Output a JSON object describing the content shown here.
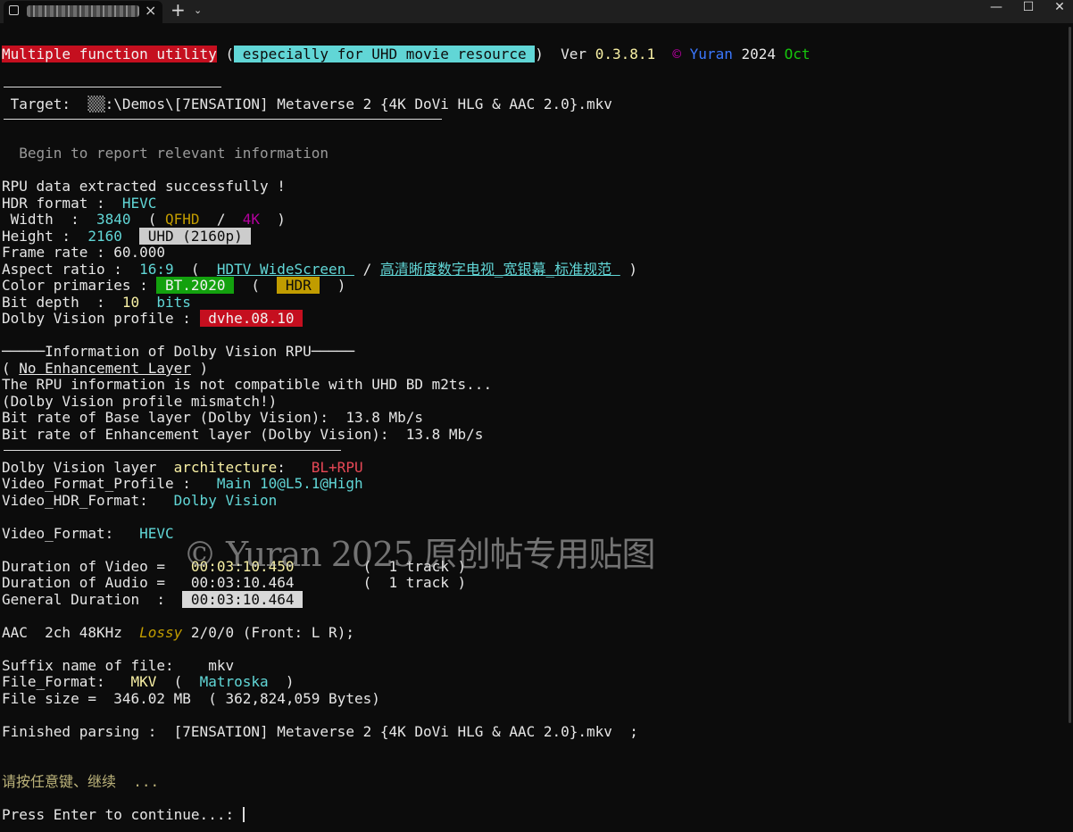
{
  "window": {
    "tab_close": "×",
    "new_tab": "+",
    "dropdown": "⌄",
    "minimize": "—",
    "maximize": "☐",
    "close": "✕"
  },
  "header": {
    "app_badge": "Multiple function utility",
    "paren_open": " (",
    "sub_badge": " especially for UHD movie resource ",
    "paren_close": ")",
    "ver_label": "  Ver ",
    "ver": "0.3.8.1",
    "copyright": "  ©",
    "author": " Yuran",
    "year": " 2024",
    "month": " Oct"
  },
  "target": {
    "label": " Target:  ",
    "drive": "▒▒",
    "path": ":\\Demos\\[7ENSATION] Metaverse 2 {4K DoVi HLG & AAC 2.0}.mkv"
  },
  "begin_msg": "  Begin to report relevant information",
  "info": {
    "rpu_ok": "RPU data extracted successfully !",
    "hdr_label": "HDR format :  ",
    "hdr_value": "HEVC",
    "width_label": " Width  :  ",
    "width_value": "3840",
    "width_paren_open": "  ( ",
    "width_qfhd": "QFHD",
    "width_slash": "  /  ",
    "width_4k": "4K",
    "width_paren_close": "  )",
    "height_label": "Height :  ",
    "height_value": "2160",
    "height_badge": " UHD (2160p) ",
    "fps_label": "Frame rate : ",
    "fps_value": "60.000",
    "aspect_label": "Aspect ratio :  ",
    "aspect_value": "16:9",
    "aspect_paren_open": "  (  ",
    "aspect_en": "HDTV WideScreen ",
    "aspect_slash": " / ",
    "aspect_cn": "高清晰度数字电视_宽银幕_标准规范 ",
    "aspect_paren_close": " )",
    "primaries_label": "Color primaries : ",
    "primaries_value": " BT.2020 ",
    "primaries_paren_open": "  (  ",
    "primaries_hdr": " HDR ",
    "primaries_paren_close": "  )",
    "depth_label": "Bit depth  :  ",
    "depth_value": "10",
    "depth_unit": "  bits",
    "profile_label": "Dolby Vision profile : ",
    "profile_value": " dvhe.08.10 "
  },
  "rpu_section": {
    "heading": "─────Information of Dolby Vision RPU─────",
    "paren_open": "( ",
    "no_el": "No Enhancement Layer",
    "paren_close": " )",
    "incompatible": "The RPU information is not compatible with UHD BD m2ts...",
    "mismatch": "(Dolby Vision profile mismatch!)",
    "bl_rate": "Bit rate of Base layer (Dolby Vision):  13.8 Mb/s",
    "el_rate": "Bit rate of Enhancement layer (Dolby Vision):  13.8 Mb/s"
  },
  "video": {
    "layer_label": "Dolby Vision layer  ",
    "layer_word": "architecture",
    "layer_colon": ":   ",
    "layer_value": "BL+RPU",
    "profile_label": "Video_Format_Profile :   ",
    "profile_value": "Main 10@L5.1@High",
    "hdr_label": "Video_HDR_Format:   ",
    "hdr_value": "Dolby Vision",
    "format_label": "Video_Format:   ",
    "format_value": "HEVC"
  },
  "duration": {
    "video_label": "Duration of Video =   ",
    "video_value": "00:03:10.450",
    "video_track": "        (  1 track )",
    "audio_label": "Duration of Audio =   ",
    "audio_value": "00:03:10.464",
    "audio_track": "        (  1 track )",
    "general_label": "General Duration  :  ",
    "general_value": " 00:03:10.464 "
  },
  "audio": {
    "prefix": "AAC  2ch 48KHz  ",
    "lossy": "Lossy",
    "suffix": " 2/0/0 (Front: L R);"
  },
  "file": {
    "suffix_label": "Suffix name of file:    ",
    "suffix_value": "mkv",
    "format_label": "File_Format:   ",
    "format_value": "MKV",
    "format_paren_open": "  (  ",
    "format_name": "Matroska",
    "format_paren_close": "  )",
    "size": "File size =  346.02 MB  ( 362,824,059 Bytes)"
  },
  "finished": "Finished parsing :  [7ENSATION] Metaverse 2 {4K DoVi HLG & AAC 2.0}.mkv  ;",
  "press_any_key_cn": "请按任意键、继续  ...",
  "press_enter": "Press Enter to continue...: ",
  "watermark": "© Yuran 2025 原创帖专用贴图"
}
